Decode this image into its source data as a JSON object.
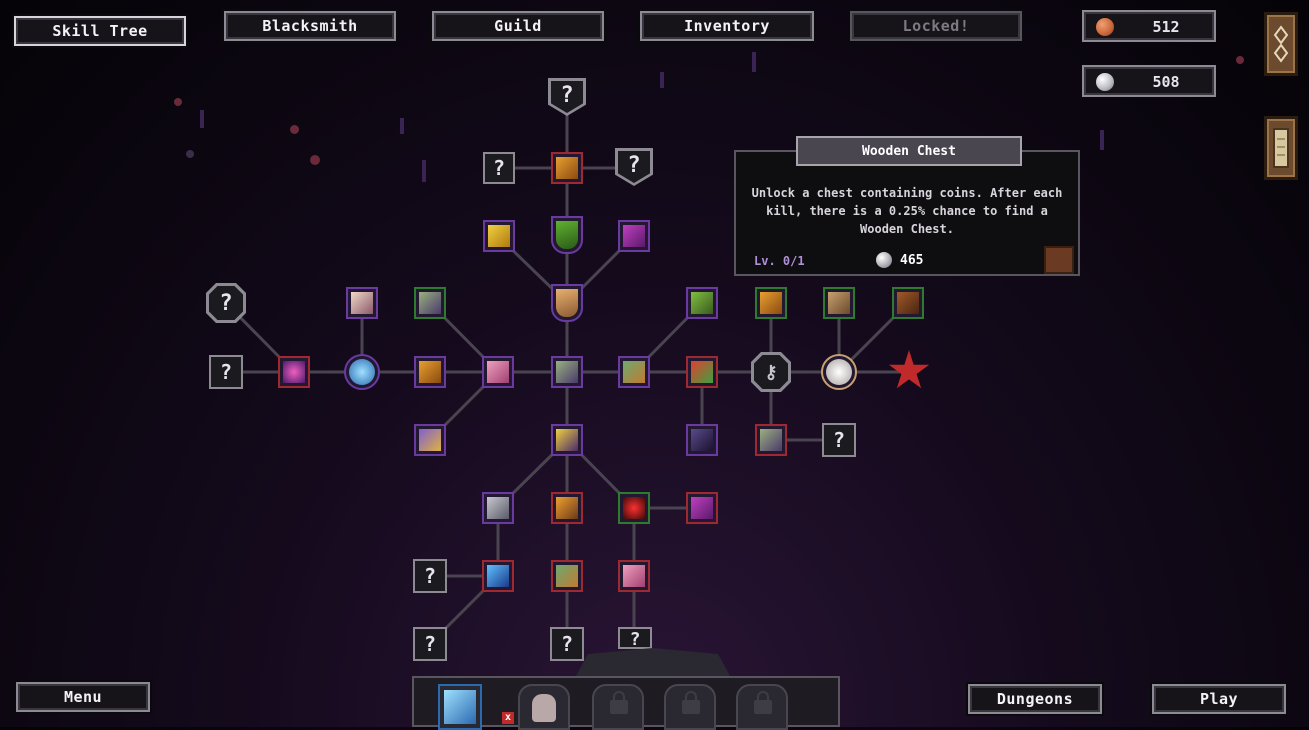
{
  "top_nav": {
    "skill_tree": "Skill Tree",
    "blacksmith": "Blacksmith",
    "guild": "Guild",
    "inventory": "Inventory",
    "locked": "Locked!"
  },
  "resources": {
    "copper": {
      "value": "512",
      "icon": "copper-coin-icon",
      "color": "#c8663a"
    },
    "silver": {
      "value": "508",
      "icon": "silver-coin-icon",
      "color": "#b8b8c0"
    }
  },
  "tooltip": {
    "title": "Wooden Chest",
    "description": "Unlock a chest containing coins. After each kill, there is a 0.25% chance to find a Wooden Chest.",
    "level": "Lv. 0/1",
    "cost": "465",
    "icon": "wooden-chest-icon"
  },
  "unknown_label": "?",
  "bottom": {
    "menu": "Menu",
    "dungeons": "Dungeons",
    "play": "Play",
    "remove_mark": "x"
  },
  "colors": {
    "frame": "#8e8a94",
    "link": "#4a4450",
    "red_border": "#a02830",
    "green_border": "#2e7a2e",
    "purple_border": "#6a3aa0"
  }
}
